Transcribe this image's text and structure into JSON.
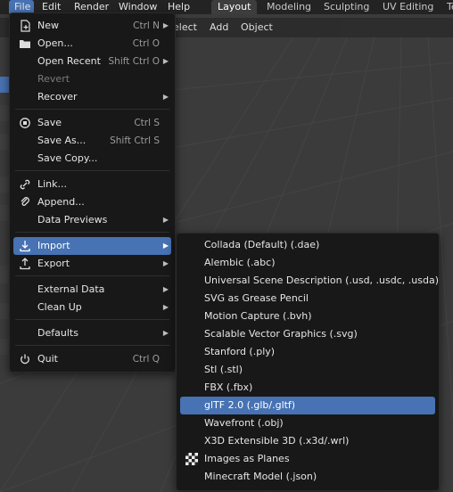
{
  "topbar": {
    "menus": [
      "File",
      "Edit",
      "Render",
      "Window",
      "Help"
    ],
    "workspaces": [
      "Layout",
      "Modeling",
      "Sculpting",
      "UV Editing",
      "Te"
    ]
  },
  "viewport_header": {
    "items": [
      "elect",
      "Add",
      "Object"
    ]
  },
  "file_menu": {
    "items": [
      {
        "label": "New",
        "shortcut": "Ctrl N",
        "submenu": true,
        "icon": "new-file-icon"
      },
      {
        "label": "Open...",
        "shortcut": "Ctrl O",
        "icon": "folder-icon"
      },
      {
        "label": "Open Recent",
        "shortcut": "Shift Ctrl O",
        "submenu": true
      },
      {
        "label": "Revert",
        "disabled": true
      },
      {
        "label": "Recover",
        "submenu": true
      },
      {
        "label": "Save",
        "shortcut": "Ctrl S",
        "icon": "save-icon"
      },
      {
        "label": "Save As...",
        "shortcut": "Shift Ctrl S"
      },
      {
        "label": "Save Copy..."
      },
      {
        "label": "Link...",
        "icon": "link-icon"
      },
      {
        "label": "Append...",
        "icon": "append-icon"
      },
      {
        "label": "Data Previews",
        "submenu": true
      },
      {
        "label": "Import",
        "submenu": true,
        "icon": "import-icon",
        "highlighted": true
      },
      {
        "label": "Export",
        "submenu": true,
        "icon": "export-icon"
      },
      {
        "label": "External Data",
        "submenu": true
      },
      {
        "label": "Clean Up",
        "submenu": true
      },
      {
        "label": "Defaults",
        "submenu": true
      },
      {
        "label": "Quit",
        "shortcut": "Ctrl Q",
        "icon": "power-icon"
      }
    ]
  },
  "import_menu": {
    "items": [
      {
        "label": "Collada (Default) (.dae)"
      },
      {
        "label": "Alembic (.abc)"
      },
      {
        "label": "Universal Scene Description (.usd, .usdc, .usda)"
      },
      {
        "label": "SVG as Grease Pencil"
      },
      {
        "label": "Motion Capture (.bvh)"
      },
      {
        "label": "Scalable Vector Graphics (.svg)"
      },
      {
        "label": "Stanford (.ply)"
      },
      {
        "label": "Stl (.stl)"
      },
      {
        "label": "FBX (.fbx)"
      },
      {
        "label": "glTF 2.0 (.glb/.gltf)",
        "highlighted": true
      },
      {
        "label": "Wavefront (.obj)"
      },
      {
        "label": "X3D Extensible 3D (.x3d/.wrl)"
      },
      {
        "label": "Images as Planes",
        "icon": "checker-icon"
      },
      {
        "label": "Minecraft Model (.json)"
      }
    ]
  },
  "colors": {
    "accent": "#4772b3",
    "menu_bg": "#181818",
    "viewport_bg": "#3b3b3b"
  }
}
